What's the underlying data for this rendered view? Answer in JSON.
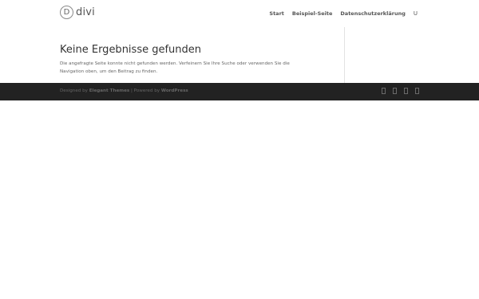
{
  "header": {
    "logo_text": "divi",
    "logo_mark": "D",
    "nav": [
      {
        "label": "Start"
      },
      {
        "label": "Beispiel-Seite"
      },
      {
        "label": "Datenschutzerklärung"
      }
    ],
    "search_glyph": "U"
  },
  "main": {
    "title": "Keine Ergebnisse gefunden",
    "message": "Die angefragte Seite konnte nicht gefunden werden. Verfeinern Sie Ihre Suche oder verwenden Sie die Navigation oben, um den Beitrag zu finden."
  },
  "footer": {
    "designed_by_prefix": "Designed by ",
    "designer_link": "Elegant Themes",
    "separator": " | Powered by ",
    "powered_link": "WordPress",
    "social_icons": [
      "facebook-icon",
      "twitter-icon",
      "instagram-icon",
      "rss-icon"
    ]
  },
  "colors": {
    "footer_bg": "#222222",
    "text": "#666666",
    "title": "#333333"
  }
}
